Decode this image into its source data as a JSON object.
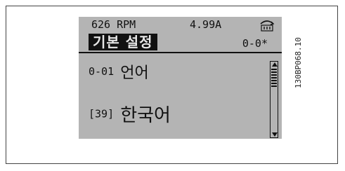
{
  "display": {
    "speed": "626 RPM",
    "current": "4.99A",
    "title": "기본 설정",
    "param_number": "0-0*",
    "param_code": "0-01",
    "param_name": "언어",
    "value_index": "[39]",
    "value_name": "한국어"
  },
  "figure_code": "130BP068.10",
  "icons": {
    "status": "hand-mode-icon",
    "scroll": "scroll-thumb"
  },
  "colors": {
    "lcd_background": "#b4b4b4",
    "text": "#111111",
    "title_highlight": "#111111"
  }
}
